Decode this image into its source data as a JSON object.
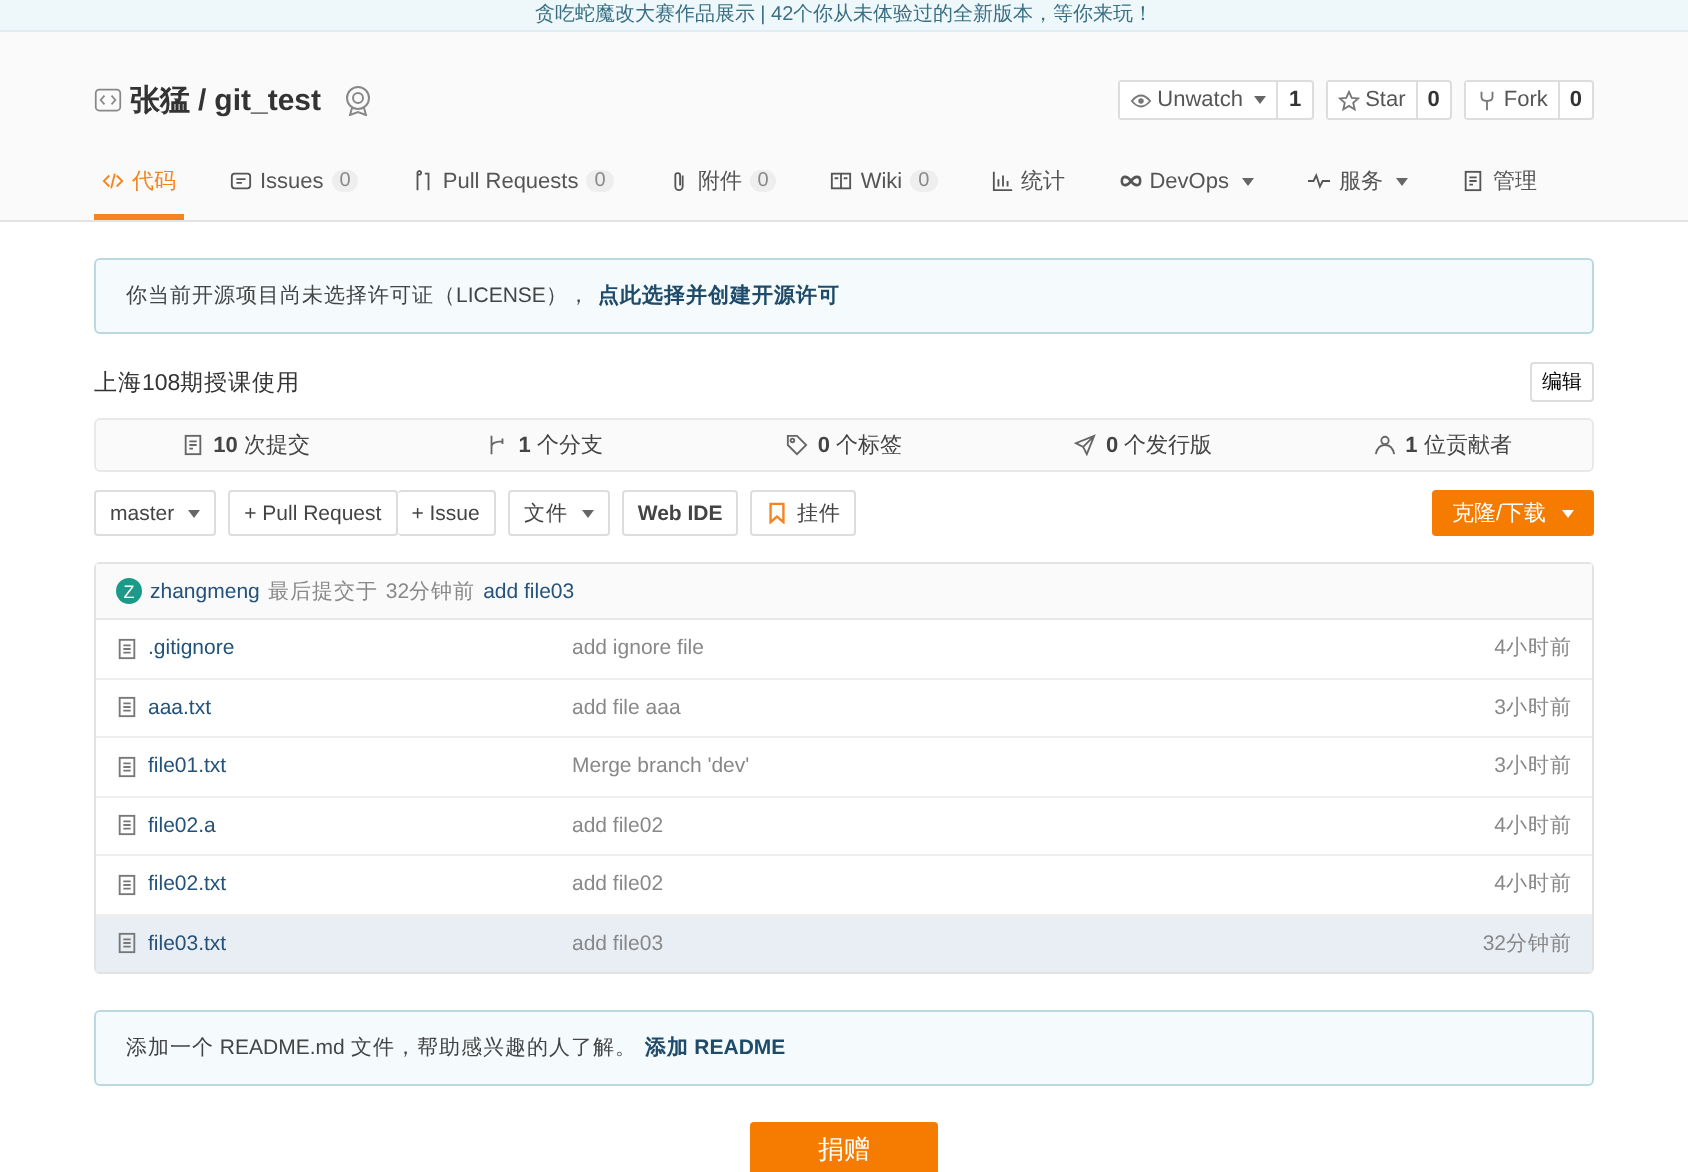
{
  "banner": {
    "text": "贪吃蛇魔改大赛作品展示 | 42个你从未体验过的全新版本，等你来玩！"
  },
  "repo": {
    "owner": "张猛",
    "separator": "/",
    "name": "git_test"
  },
  "actions": [
    {
      "kind": "watch",
      "label": "Unwatch",
      "dropdown": true,
      "count": "1"
    },
    {
      "kind": "star",
      "label": "Star",
      "dropdown": false,
      "count": "0"
    },
    {
      "kind": "fork",
      "label": "Fork",
      "dropdown": false,
      "count": "0"
    }
  ],
  "tabs": [
    {
      "label": "代码",
      "dropdown": false,
      "selected": true
    },
    {
      "label": "Issues",
      "count": "0",
      "dropdown": false,
      "selected": false
    },
    {
      "label": "Pull Requests",
      "count": "0",
      "dropdown": false,
      "selected": false
    },
    {
      "label": "附件",
      "count": "0",
      "dropdown": false,
      "selected": false
    },
    {
      "label": "Wiki",
      "count": "0",
      "dropdown": false,
      "selected": false
    },
    {
      "label": "统计",
      "dropdown": false,
      "selected": false
    },
    {
      "label": "DevOps",
      "dropdown": true,
      "selected": false
    },
    {
      "label": "服务",
      "dropdown": true,
      "selected": false
    },
    {
      "label": "管理",
      "dropdown": false,
      "selected": false
    }
  ],
  "license_notice": {
    "text": "你当前开源项目尚未选择许可证（LICENSE），",
    "link": "点此选择并创建开源许可"
  },
  "description": "上海108期授课使用",
  "edit_button": "编辑",
  "stats": [
    {
      "number": "10",
      "label": "次提交"
    },
    {
      "number": "1",
      "label": "个分支"
    },
    {
      "number": "0",
      "label": "个标签"
    },
    {
      "number": "0",
      "label": "个发行版"
    },
    {
      "number": "1",
      "label": "位贡献者"
    }
  ],
  "toolbar": {
    "branch": "master",
    "pull_request": "+ Pull Request",
    "issue": "+ Issue",
    "file": "文件",
    "web_ide": "Web IDE",
    "widget": "挂件",
    "clone": "克隆/下载"
  },
  "last_commit": {
    "avatar": "Z",
    "author": "zhangmeng",
    "prefix": "最后提交于",
    "time": "32分钟前",
    "message": "add file03"
  },
  "files": [
    {
      "name": ".gitignore",
      "message": "add ignore file",
      "time": "4小时前",
      "highlighted": false
    },
    {
      "name": "aaa.txt",
      "message": "add file aaa",
      "time": "3小时前",
      "highlighted": false
    },
    {
      "name": "file01.txt",
      "message": "Merge branch 'dev'",
      "time": "3小时前",
      "highlighted": false
    },
    {
      "name": "file02.a",
      "message": "add file02",
      "time": "4小时前",
      "highlighted": false
    },
    {
      "name": "file02.txt",
      "message": "add file02",
      "time": "4小时前",
      "highlighted": false
    },
    {
      "name": "file03.txt",
      "message": "add file03",
      "time": "32分钟前",
      "highlighted": true
    }
  ],
  "readme_notice": {
    "text": "添加一个 README.md 文件，帮助感兴趣的人了解。",
    "link": "添加 README"
  },
  "donate_button": "捐赠"
}
